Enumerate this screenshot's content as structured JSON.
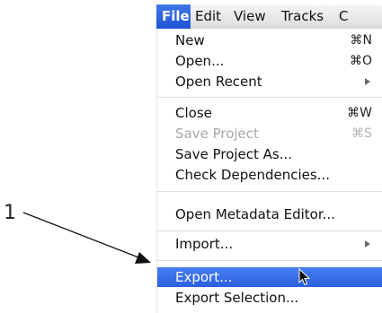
{
  "menubar": {
    "items": [
      {
        "label": "File"
      },
      {
        "label": "Edit"
      },
      {
        "label": "View"
      },
      {
        "label": "Tracks"
      },
      {
        "label": "C"
      }
    ]
  },
  "file_menu": {
    "items": [
      {
        "label": "New",
        "shortcut": "⌘N"
      },
      {
        "label": "Open...",
        "shortcut": "⌘O"
      },
      {
        "label": "Open Recent"
      },
      {
        "label": "Close",
        "shortcut": "⌘W"
      },
      {
        "label": "Save Project",
        "shortcut": "⌘S"
      },
      {
        "label": "Save Project As..."
      },
      {
        "label": "Check Dependencies..."
      },
      {
        "label": "Open Metadata Editor..."
      },
      {
        "label": "Import..."
      },
      {
        "label": "Export..."
      },
      {
        "label": "Export Selection..."
      }
    ]
  },
  "callout": {
    "number": "1"
  }
}
